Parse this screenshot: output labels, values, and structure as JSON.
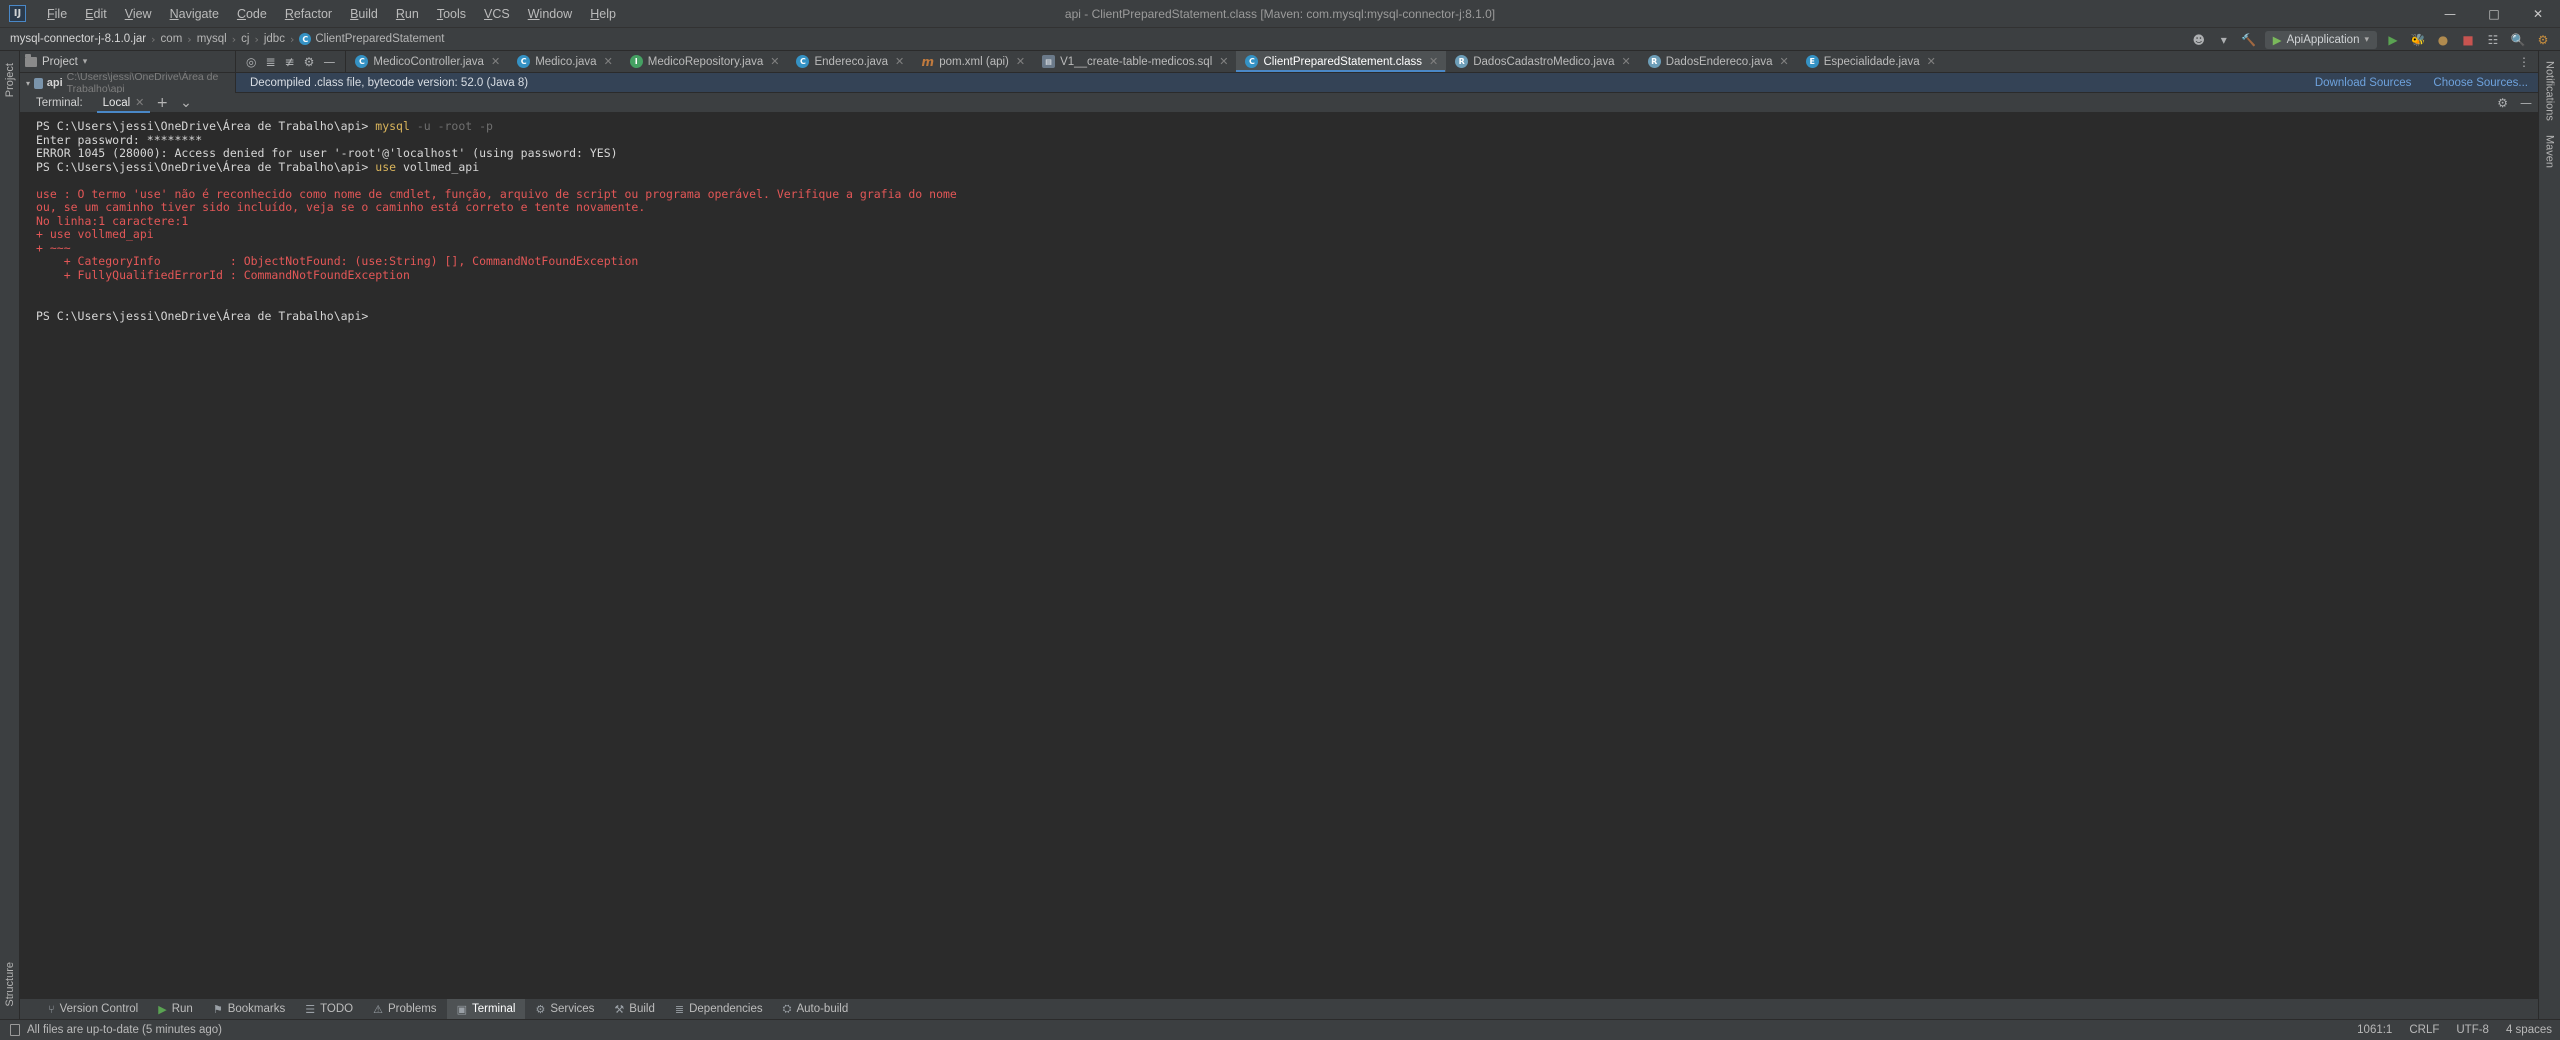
{
  "window": {
    "title": "api - ClientPreparedStatement.class [Maven: com.mysql:mysql-connector-j:8.1.0]",
    "logo": "IJ",
    "minimize": "—",
    "maximize": "□",
    "close": "✕"
  },
  "menu": [
    {
      "label": "File"
    },
    {
      "label": "Edit"
    },
    {
      "label": "View"
    },
    {
      "label": "Navigate"
    },
    {
      "label": "Code"
    },
    {
      "label": "Refactor"
    },
    {
      "label": "Build"
    },
    {
      "label": "Run"
    },
    {
      "label": "Tools"
    },
    {
      "label": "VCS"
    },
    {
      "label": "Window"
    },
    {
      "label": "Help"
    }
  ],
  "breadcrumb": {
    "items": [
      {
        "label": "mysql-connector-j-8.1.0.jar",
        "icon": "jar-icon"
      },
      {
        "label": "com",
        "icon": "package-icon"
      },
      {
        "label": "mysql",
        "icon": "package-icon"
      },
      {
        "label": "cj",
        "icon": "package-icon"
      },
      {
        "label": "jdbc",
        "icon": "package-icon"
      },
      {
        "label": "ClientPreparedStatement",
        "icon": "class-icon"
      }
    ],
    "separator": "›"
  },
  "nav_right": {
    "run_config": "ApiApplication",
    "account_icon": "account-icon",
    "build_icon": "hammer-icon",
    "run_icon": "▶",
    "debug_icon": "debug-icon",
    "stop_icon": "■",
    "coverage_icon": "coverage-icon",
    "profiler_icon": "profiler-icon",
    "search_icon": "⌕",
    "settings_icon": "⚙"
  },
  "project_panel": {
    "title": "Project",
    "module_name": "api",
    "module_path": "C:\\Users\\jessi\\OneDrive\\Área de Trabalho\\api",
    "toolbar_icons": [
      "target-icon",
      "collapse-all-icon",
      "expand-all-icon",
      "gear-icon",
      "minimize-icon"
    ]
  },
  "editor_tabs": [
    {
      "label": "MedicoController.java",
      "type": "c",
      "glyph": "C",
      "active": false
    },
    {
      "label": "Medico.java",
      "type": "c",
      "glyph": "C",
      "active": false
    },
    {
      "label": "MedicoRepository.java",
      "type": "i",
      "glyph": "I",
      "active": false
    },
    {
      "label": "Endereco.java",
      "type": "c",
      "glyph": "C",
      "active": false
    },
    {
      "label": "pom.xml (api)",
      "type": "m",
      "glyph": "m",
      "active": false
    },
    {
      "label": "V1__create-table-medicos.sql",
      "type": "sql",
      "glyph": "▤",
      "active": false
    },
    {
      "label": "ClientPreparedStatement.class",
      "type": "c",
      "glyph": "C",
      "active": true
    },
    {
      "label": "DadosCadastroMedico.java",
      "type": "r",
      "glyph": "R",
      "active": false
    },
    {
      "label": "DadosEndereco.java",
      "type": "r",
      "glyph": "R",
      "active": false
    },
    {
      "label": "Especialidade.java",
      "type": "e",
      "glyph": "E",
      "active": false
    }
  ],
  "notification": {
    "message": "Decompiled .class file, bytecode version: 52.0 (Java 8)",
    "links": [
      "Download Sources",
      "Choose Sources..."
    ]
  },
  "terminal": {
    "label": "Terminal:",
    "tab": "Local",
    "add": "+",
    "dropdown": "⌄",
    "close": "✕",
    "lines": [
      {
        "segments": [
          {
            "text": "PS C:\\Users\\jessi\\OneDrive\\Área de Trabalho\\api> ",
            "cls": "c-prompt"
          },
          {
            "text": "mysql",
            "cls": "c-cmd"
          },
          {
            "text": " -u -root -p",
            "cls": "c-arg"
          }
        ]
      },
      {
        "segments": [
          {
            "text": "Enter password: ********",
            "cls": "c-prompt"
          }
        ]
      },
      {
        "segments": [
          {
            "text": "ERROR 1045 (28000): Access denied for user '-root'@'localhost' (using password: YES)",
            "cls": "c-prompt"
          }
        ]
      },
      {
        "segments": [
          {
            "text": "PS C:\\Users\\jessi\\OneDrive\\Área de Trabalho\\api> ",
            "cls": "c-prompt"
          },
          {
            "text": "use",
            "cls": "c-cmd"
          },
          {
            "text": " vollmed_api",
            "cls": "c-prompt"
          }
        ]
      },
      {
        "segments": [
          {
            "text": "",
            "cls": "c-blank"
          }
        ]
      },
      {
        "segments": [
          {
            "text": "use : O termo 'use' não é reconhecido como nome de cmdlet, função, arquivo de script ou programa operável. Verifique a grafia do nome",
            "cls": "c-err"
          }
        ]
      },
      {
        "segments": [
          {
            "text": "ou, se um caminho tiver sido incluído, veja se o caminho está correto e tente novamente.",
            "cls": "c-err"
          }
        ]
      },
      {
        "segments": [
          {
            "text": "No linha:1 caractere:1",
            "cls": "c-err"
          }
        ]
      },
      {
        "segments": [
          {
            "text": "+ use vollmed_api",
            "cls": "c-err"
          }
        ]
      },
      {
        "segments": [
          {
            "text": "+ ~~~",
            "cls": "c-err"
          }
        ]
      },
      {
        "segments": [
          {
            "text": "    + CategoryInfo          : ObjectNotFound: (use:String) [], CommandNotFoundException",
            "cls": "c-err"
          }
        ]
      },
      {
        "segments": [
          {
            "text": "    + FullyQualifiedErrorId : CommandNotFoundException",
            "cls": "c-err"
          }
        ]
      },
      {
        "segments": [
          {
            "text": "",
            "cls": "c-blank"
          }
        ]
      },
      {
        "segments": [
          {
            "text": "",
            "cls": "c-blank"
          }
        ]
      },
      {
        "segments": [
          {
            "text": "PS C:\\Users\\jessi\\OneDrive\\Área de Trabalho\\api>",
            "cls": "c-prompt"
          }
        ]
      }
    ]
  },
  "bottom_bar": [
    {
      "label": "Version Control",
      "icon": "branch-icon",
      "active": false
    },
    {
      "label": "Run",
      "icon": "run-icon",
      "active": false
    },
    {
      "label": "Bookmarks",
      "icon": "bookmark-icon",
      "active": false
    },
    {
      "label": "TODO",
      "icon": "todo-icon",
      "active": false
    },
    {
      "label": "Problems",
      "icon": "problems-icon",
      "active": false
    },
    {
      "label": "Terminal",
      "icon": "terminal-icon",
      "active": true
    },
    {
      "label": "Services",
      "icon": "services-icon",
      "active": false
    },
    {
      "label": "Build",
      "icon": "build-icon",
      "active": false
    },
    {
      "label": "Dependencies",
      "icon": "dependencies-icon",
      "active": false
    },
    {
      "label": "Auto-build",
      "icon": "autobuild-icon",
      "active": false
    }
  ],
  "status_bar": {
    "message": "All files are up-to-date (5 minutes ago)",
    "caret": "1061:1",
    "line_sep": "CRLF",
    "encoding": "UTF-8",
    "indent": "4 spaces"
  },
  "left_strip": [
    {
      "label": "Project"
    },
    {
      "label": "Structure"
    }
  ],
  "right_strip": [
    {
      "label": "Notifications"
    },
    {
      "label": "Maven"
    }
  ],
  "colors": {
    "accent": "#4a88c7",
    "error": "#e35757",
    "command": "#d9b45b",
    "link": "#6ea2dd",
    "background": "#3c3f41",
    "terminal_bg": "#2b2b2b",
    "notif_bg": "#344356"
  }
}
